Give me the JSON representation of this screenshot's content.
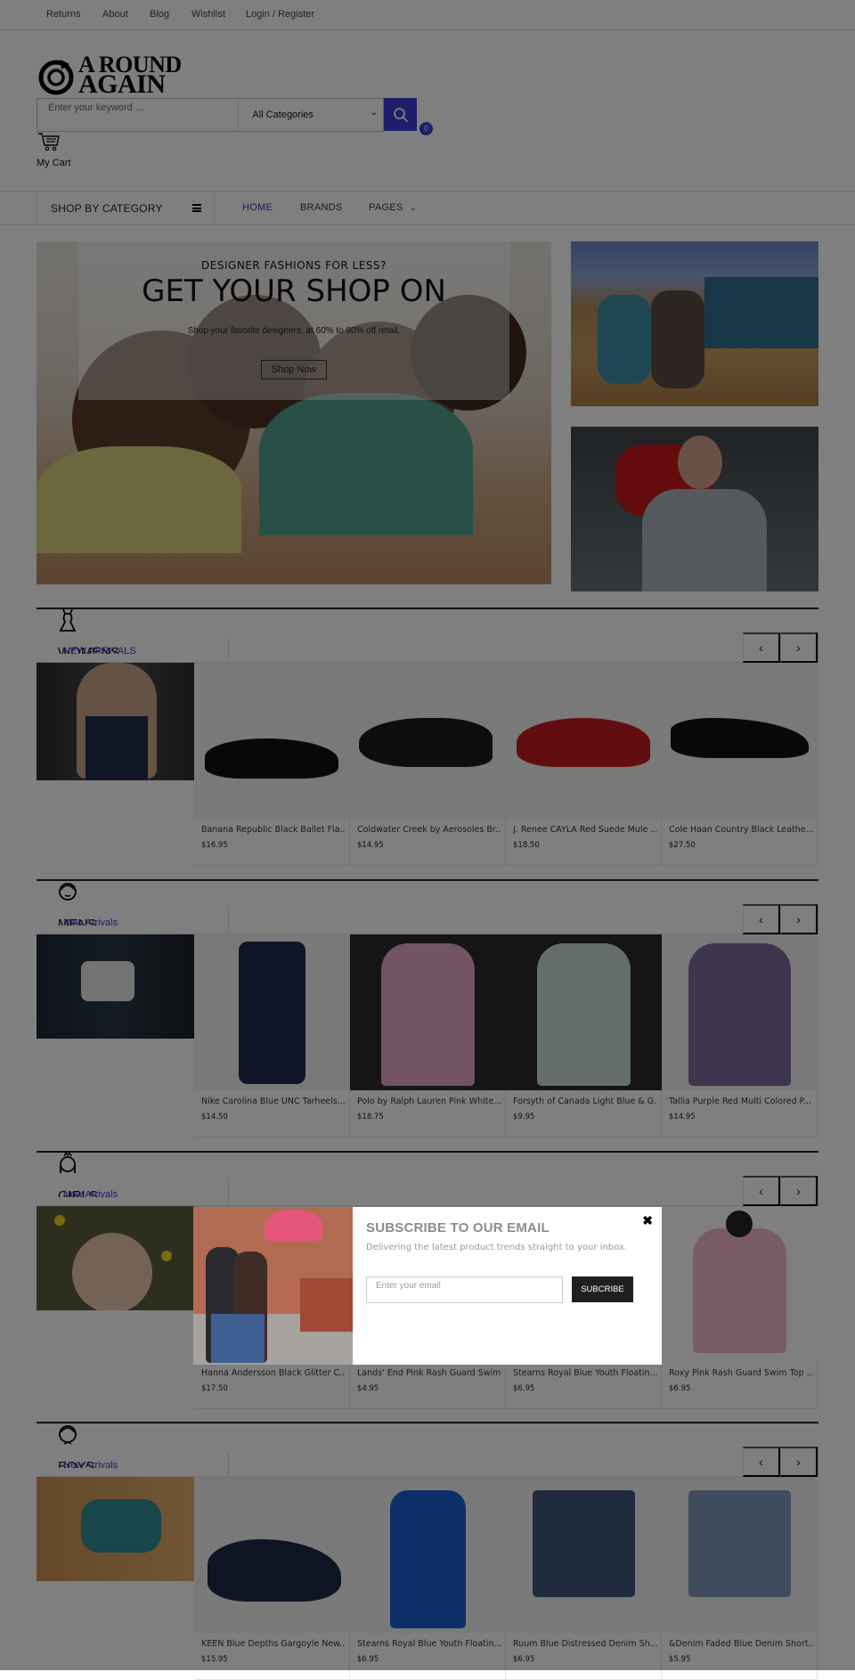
{
  "topbar": {
    "links": [
      "Returns",
      "About",
      "Blog",
      "Wishlist",
      "Login / Register"
    ]
  },
  "header": {
    "logo_line1": "A ROUND",
    "logo_line2": "AGAIN",
    "search_placeholder": "Enter your keyword ...",
    "category_selected": "All Categories",
    "cart_count": "0",
    "cart_label": "My Cart"
  },
  "nav": {
    "category_toggle": "SHOP BY CATEGORY",
    "links": [
      "HOME",
      "BRANDS",
      "PAGES"
    ],
    "accent": "#3535b5"
  },
  "hero": {
    "eyebrow": "DESIGNER FASHIONS FOR LESS?",
    "title": "GET YOUR SHOP ON",
    "subtitle": "Shop your favorite designers, at 60% to 90% off retail.",
    "button": "Shop Now"
  },
  "sections": [
    {
      "title": "WOMENS",
      "subtitle": "NEW ARRIVALS",
      "icon": "dress-icon",
      "products": [
        {
          "name": "Banana Republic Black Ballet Fla...",
          "price": "$16.95"
        },
        {
          "name": "Coldwater Creek by Aerosoles Br...",
          "price": "$14.95"
        },
        {
          "name": "J. Renee CAYLA Red Suede Mule ...",
          "price": "$18.50"
        },
        {
          "name": "Cole Haan Country Black Leathe...",
          "price": "$27.50"
        }
      ]
    },
    {
      "title": "MENS",
      "subtitle": "New Arrivals",
      "icon": "man-face-icon",
      "products": [
        {
          "name": "Nike Carolina Blue UNC Tarheels...",
          "price": "$14.50"
        },
        {
          "name": "Polo by Ralph Lauren Pink White...",
          "price": "$18.75"
        },
        {
          "name": "Forsyth of Canada Light Blue & G...",
          "price": "$9.95"
        },
        {
          "name": "Tallia Purple Red Multi Colored P...",
          "price": "$14.95"
        }
      ]
    },
    {
      "title": "GIRLS",
      "subtitle": "New Arrivals",
      "icon": "girl-face-icon",
      "products": [
        {
          "name": "Hanna Andersson Black Glitter C...",
          "price": "$17.50"
        },
        {
          "name": "Lands' End Pink Rash Guard Swim...",
          "price": "$4.95"
        },
        {
          "name": "Stearns Royal Blue Youth Floatin...",
          "price": "$6.95"
        },
        {
          "name": "Roxy Pink Rash Guard Swim Top ...",
          "price": "$6.95"
        }
      ]
    },
    {
      "title": "BOYS",
      "subtitle": "New Arrivals",
      "icon": "boy-face-icon",
      "products": [
        {
          "name": "KEEN Blue Depths Gargoyle New...",
          "price": "$15.95"
        },
        {
          "name": "Stearns Royal Blue Youth Floatin...",
          "price": "$6.95"
        },
        {
          "name": "Ruum Blue Distressed Denim Sh...",
          "price": "$6.95"
        },
        {
          "name": "&Denim Faded Blue Denim Short...",
          "price": "$5.95"
        }
      ]
    }
  ],
  "modal": {
    "title": "SUBSCRIBE TO OUR EMAIL",
    "description": "Delivering the latest product trends straight to your inbox.",
    "email_placeholder": "Enter your email",
    "button": "SUBCRIBE",
    "close": "✖"
  },
  "colors": {
    "accent": "#3d3dd8",
    "overlay": "rgba(0,0,0,0.5)"
  }
}
